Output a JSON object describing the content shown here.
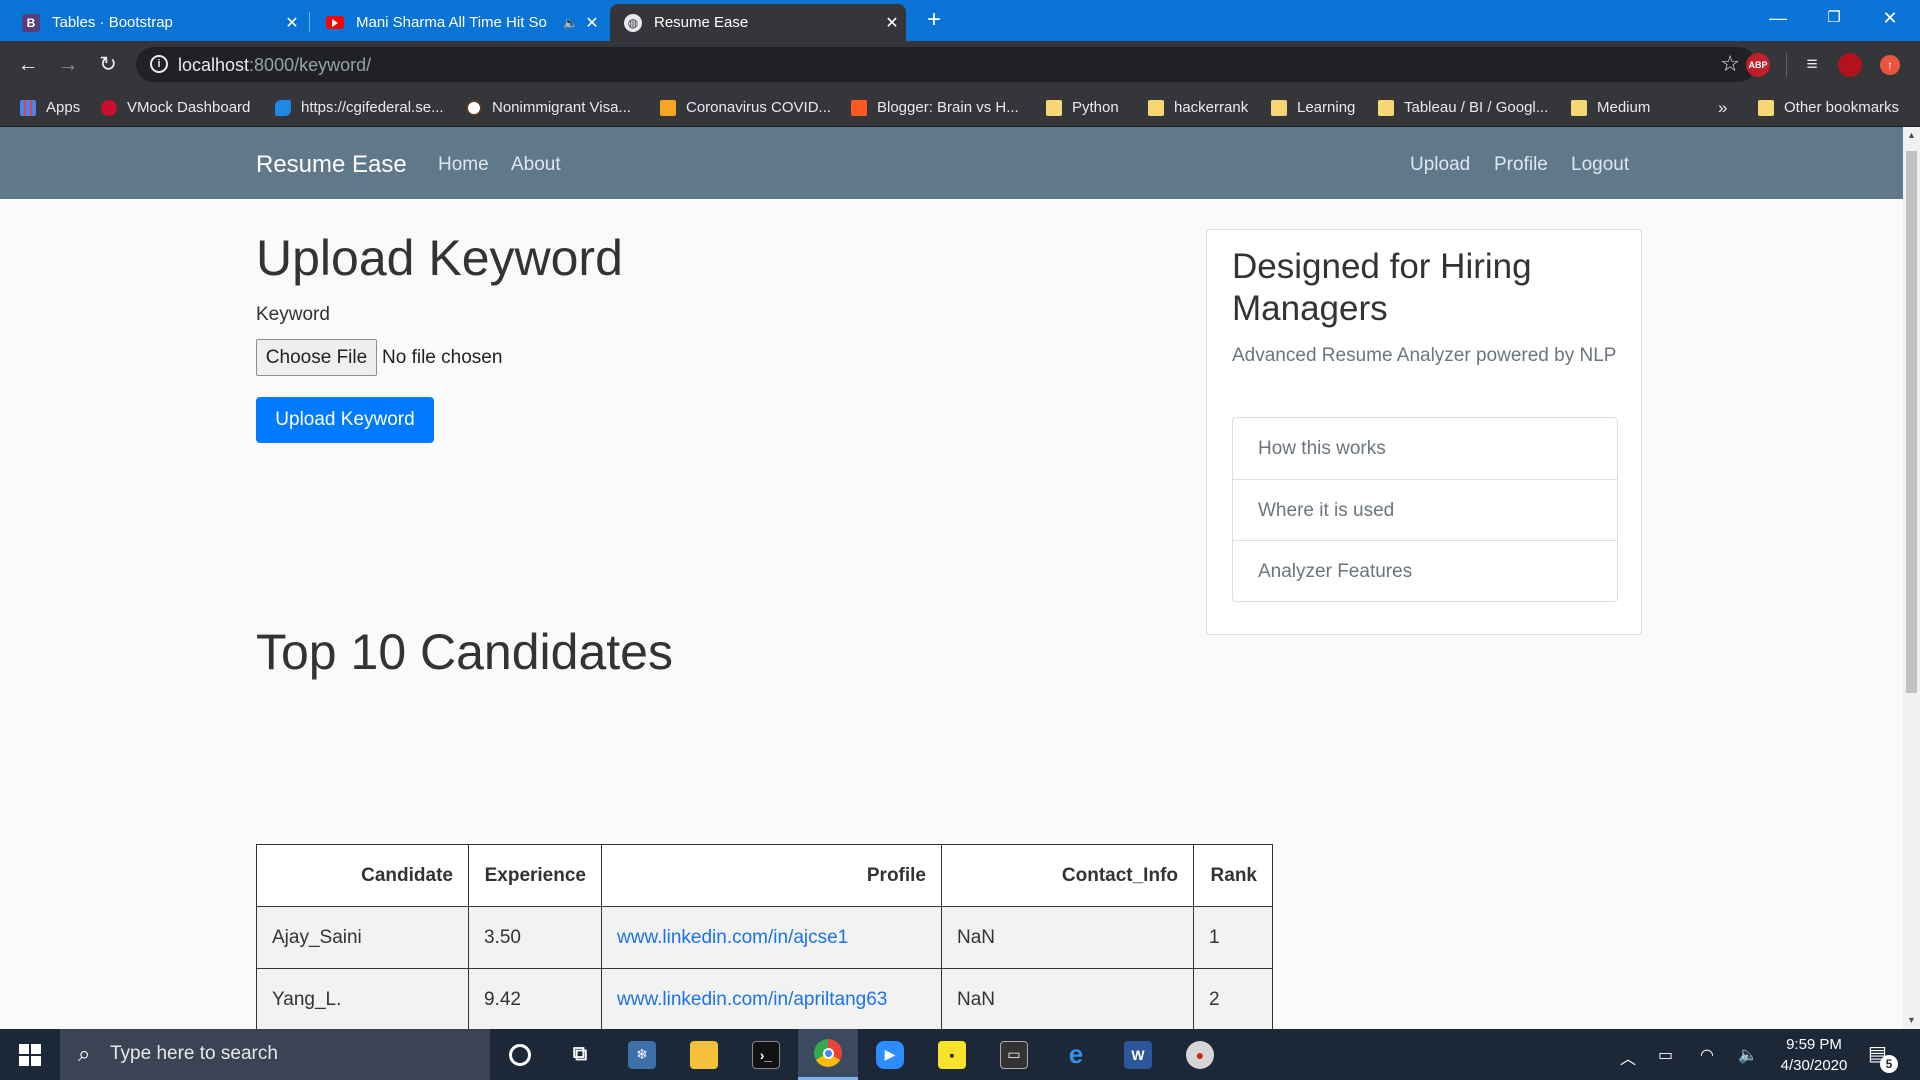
{
  "browser": {
    "tabs": [
      {
        "title": "Tables · Bootstrap",
        "favicon": "B"
      },
      {
        "title": "Mani Sharma All Time Hit So",
        "favicon": "youtube"
      },
      {
        "title": "Resume Ease",
        "favicon": "globe"
      }
    ],
    "url_host": "localhost",
    "url_path": ":8000/keyword/",
    "extensions": [
      "ABP"
    ]
  },
  "bookmarks": [
    "Apps",
    "VMock Dashboard",
    "https://cgifederal.se...",
    "Nonimmigrant Visa...",
    "Coronavirus COVID...",
    "Blogger: Brain vs H...",
    "Python",
    "hackerrank",
    "Learning",
    "Tableau / BI / Googl...",
    "Medium"
  ],
  "bookmarks_more": "»",
  "bookmarks_other": "Other bookmarks",
  "site": {
    "brand": "Resume Ease",
    "nav_left": [
      "Home",
      "About"
    ],
    "nav_right": [
      "Upload",
      "Profile",
      "Logout"
    ]
  },
  "upload": {
    "title": "Upload Keyword",
    "field_label": "Keyword",
    "file_button": "Choose File",
    "file_status": "No file chosen",
    "submit_label": "Upload Keyword"
  },
  "sidebar": {
    "heading": "Designed for Hiring Managers",
    "subtitle": "Advanced Resume Analyzer powered by NLP",
    "items": [
      "How this works",
      "Where it is used",
      "Analyzer Features"
    ]
  },
  "candidates": {
    "title": "Top 10 Candidates",
    "columns": [
      "Candidate",
      "Experience",
      "Profile",
      "Contact_Info",
      "Rank"
    ],
    "rows": [
      {
        "candidate": "Ajay_Saini",
        "experience": "3.50",
        "profile": "www.linkedin.com/in/ajcse1",
        "contact": "NaN",
        "rank": "1"
      },
      {
        "candidate": "Yang_L.",
        "experience": "9.42",
        "profile": "www.linkedin.com/in/apriltang63",
        "contact": "NaN",
        "rank": "2"
      }
    ]
  },
  "taskbar": {
    "search_placeholder": "Type here to search",
    "time": "9:59 PM",
    "date": "4/30/2020",
    "notification_count": "5"
  },
  "colors": {
    "chrome_tabstrip": "#0a73d6",
    "site_navbar": "#5f788a",
    "primary_button": "#007bff",
    "link": "#1a73e8"
  }
}
